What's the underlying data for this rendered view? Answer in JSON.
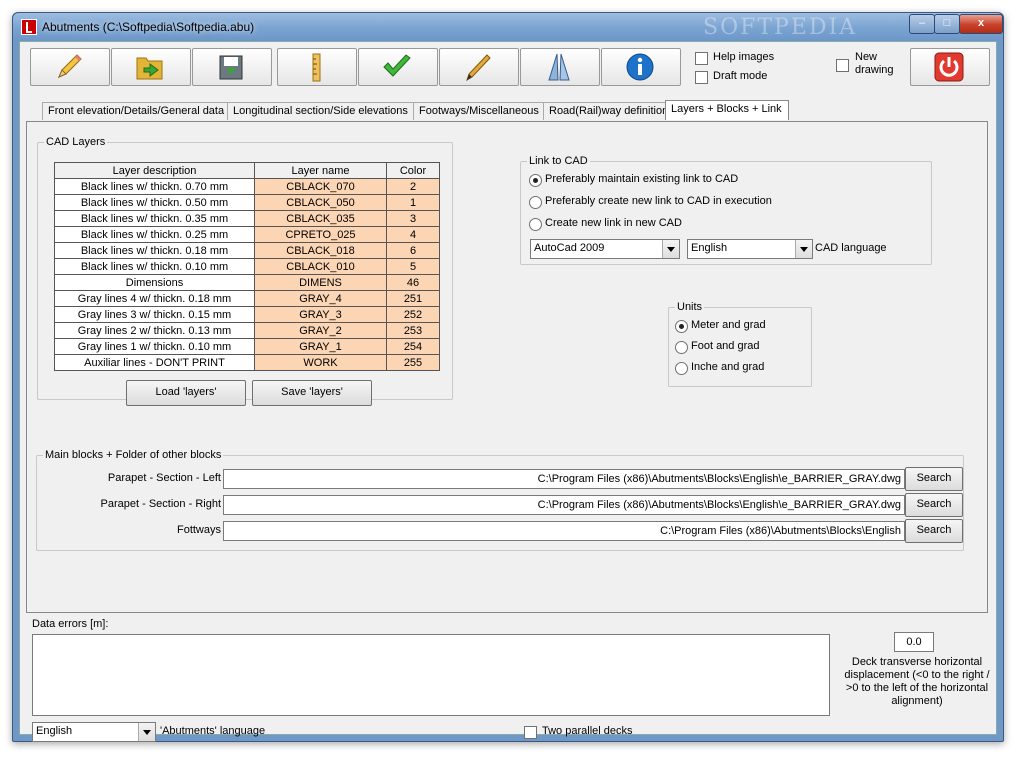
{
  "window": {
    "title": "Abutments (C:\\Softpedia\\Softpedia.abu)",
    "watermark": "SOFTPEDIA",
    "min_glyph": "–",
    "max_glyph": "□",
    "close_glyph": "x"
  },
  "toolbar": {
    "buttons": [
      {
        "name": "edit-button",
        "icon": "pencil-icon"
      },
      {
        "name": "open-button",
        "icon": "folder-open-icon"
      },
      {
        "name": "save-button",
        "icon": "save-disk-icon"
      },
      {
        "name": "ruler-button",
        "icon": "ruler-icon"
      },
      {
        "name": "check-button",
        "icon": "checkmark-icon"
      },
      {
        "name": "draw-button",
        "icon": "pen-icon"
      },
      {
        "name": "abutment-button",
        "icon": "abutment-icon"
      },
      {
        "name": "info-button",
        "icon": "info-icon"
      },
      {
        "name": "exit-button",
        "icon": "power-icon"
      }
    ],
    "help_images": "Help images",
    "draft_mode": "Draft mode",
    "new_drawing": [
      "New",
      "drawing"
    ]
  },
  "tabs": [
    {
      "label": "Front elevation/Details/General data"
    },
    {
      "label": "Longitudinal section/Side elevations"
    },
    {
      "label": "Footways/Miscellaneous"
    },
    {
      "label": "Road(Rail)way definition"
    },
    {
      "label": "Layers + Blocks + Link"
    }
  ],
  "cad_layers": {
    "legend": "CAD Layers",
    "headers": [
      "Layer description",
      "Layer name",
      "Color"
    ],
    "rows": [
      [
        "Black lines w/ thickn. 0.70 mm",
        "CBLACK_070",
        "2"
      ],
      [
        "Black lines w/ thickn. 0.50 mm",
        "CBLACK_050",
        "1"
      ],
      [
        "Black lines w/ thickn. 0.35 mm",
        "CBLACK_035",
        "3"
      ],
      [
        "Black lines w/ thickn. 0.25 mm",
        "CPRETO_025",
        "4"
      ],
      [
        "Black lines w/ thickn. 0.18 mm",
        "CBLACK_018",
        "6"
      ],
      [
        "Black lines w/ thickn. 0.10 mm",
        "CBLACK_010",
        "5"
      ],
      [
        "Dimensions",
        "DIMENS",
        "46"
      ],
      [
        "Gray lines 4 w/ thickn. 0.18 mm",
        "GRAY_4",
        "251"
      ],
      [
        "Gray lines 3 w/ thickn. 0.15 mm",
        "GRAY_3",
        "252"
      ],
      [
        "Gray lines 2 w/ thickn. 0.13 mm",
        "GRAY_2",
        "253"
      ],
      [
        "Gray lines 1 w/ thickn. 0.10 mm",
        "GRAY_1",
        "254"
      ],
      [
        "Auxiliar lines - DON'T PRINT",
        "WORK",
        "255"
      ]
    ],
    "load_button": "Load 'layers'",
    "save_button": "Save 'layers'"
  },
  "link_to_cad": {
    "legend": "Link to CAD",
    "options": [
      {
        "label": "Preferably maintain existing link to CAD",
        "selected": true
      },
      {
        "label": "Preferably create new link to CAD in execution",
        "selected": false
      },
      {
        "label": "Create new link in new CAD",
        "selected": false
      }
    ],
    "cad_program": "AutoCad 2009",
    "cad_language_value": "English",
    "cad_language_label": "CAD language"
  },
  "units": {
    "legend": "Units",
    "options": [
      {
        "label": "Meter and grad",
        "selected": true
      },
      {
        "label": "Foot and grad",
        "selected": false
      },
      {
        "label": "Inche and grad",
        "selected": false
      }
    ]
  },
  "blocks": {
    "legend": "Main blocks + Folder of other blocks",
    "rows": [
      {
        "label": "Parapet - Section - Left",
        "path": "C:\\Program Files (x86)\\Abutments\\Blocks\\English\\e_BARRIER_GRAY.dwg",
        "button": "Search"
      },
      {
        "label": "Parapet - Section - Right",
        "path": "C:\\Program Files (x86)\\Abutments\\Blocks\\English\\e_BARRIER_GRAY.dwg",
        "button": "Search"
      },
      {
        "label": "Fottways",
        "path": "C:\\Program Files (x86)\\Abutments\\Blocks\\English",
        "button": "Search"
      }
    ]
  },
  "bottom": {
    "data_errors_label": "Data errors [m]:",
    "deck_value": "0.0",
    "deck_label": "Deck transverse horizontal displacement (<0 to the right / >0 to the left of the horizontal alignment)",
    "language_value": "English",
    "language_label": "'Abutments' language",
    "two_parallel_decks": "Two parallel decks"
  }
}
